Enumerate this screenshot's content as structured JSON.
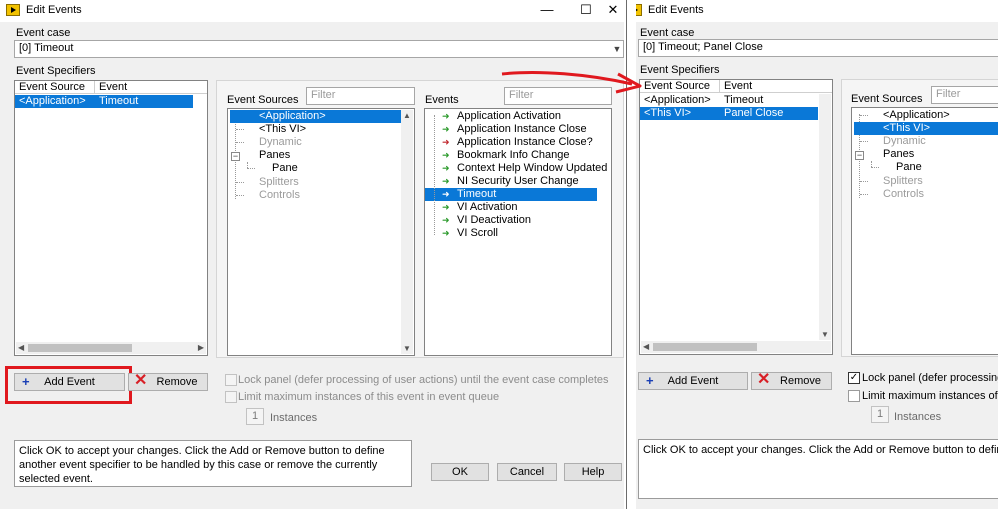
{
  "window": {
    "title": "Edit Events",
    "controls": {
      "minimize": "—",
      "maximize": "☐",
      "close": "✕"
    }
  },
  "left": {
    "event_case_label": "Event case",
    "event_case_value": "[0] Timeout",
    "event_specifiers_label": "Event Specifiers",
    "spec_columns": [
      "Event Source",
      "Event"
    ],
    "spec_rows": [
      {
        "source": "<Application>",
        "event": "Timeout",
        "selected": true
      }
    ],
    "event_sources_label": "Event Sources",
    "filter_placeholder": "Filter",
    "sources_tree": [
      {
        "label": "<Application>",
        "selected": true,
        "disabled": false
      },
      {
        "label": "<This VI>",
        "selected": false,
        "disabled": false
      },
      {
        "label": "Dynamic",
        "selected": false,
        "disabled": true
      },
      {
        "label": "Panes",
        "selected": false,
        "disabled": false
      },
      {
        "label": "Pane",
        "selected": false,
        "disabled": false
      },
      {
        "label": "Splitters",
        "selected": false,
        "disabled": true
      },
      {
        "label": "Controls",
        "selected": false,
        "disabled": true
      }
    ],
    "events_label": "Events",
    "events": [
      {
        "label": "Application Activation",
        "icon": "green-arrow",
        "selected": false
      },
      {
        "label": "Application Instance Close",
        "icon": "green-arrow",
        "selected": false
      },
      {
        "label": "Application Instance Close?",
        "icon": "red-arrow",
        "selected": false
      },
      {
        "label": "Bookmark Info Change",
        "icon": "green-arrow",
        "selected": false
      },
      {
        "label": "Context Help Window Updated",
        "icon": "green-arrow",
        "selected": false
      },
      {
        "label": "NI Security User Change",
        "icon": "green-arrow",
        "selected": false
      },
      {
        "label": "Timeout",
        "icon": "green-arrow",
        "selected": true
      },
      {
        "label": "VI Activation",
        "icon": "green-arrow",
        "selected": false
      },
      {
        "label": "VI Deactivation",
        "icon": "green-arrow",
        "selected": false
      },
      {
        "label": "VI Scroll",
        "icon": "green-arrow",
        "selected": false
      }
    ],
    "add_event": "Add Event",
    "remove": "Remove",
    "lock_panel": "Lock panel (defer processing of user actions) until the event case completes",
    "limit_instances": "Limit maximum instances of this event in event queue",
    "instances_value": "1",
    "instances_label": "Instances",
    "help_text": "Click OK to accept your changes.  Click the Add or Remove button to define another event specifier to be handled by this case or remove the currently selected event.",
    "ok": "OK",
    "cancel": "Cancel",
    "help": "Help"
  },
  "right": {
    "event_case_label": "Event case",
    "event_case_value": "[0] Timeout;  Panel Close",
    "event_specifiers_label": "Event Specifiers",
    "spec_columns": [
      "Event Source",
      "Event"
    ],
    "spec_rows": [
      {
        "source": "<Application>",
        "event": "Timeout",
        "selected": false
      },
      {
        "source": "<This VI>",
        "event": "Panel Close",
        "selected": true
      }
    ],
    "event_sources_label": "Event Sources",
    "filter_placeholder": "Filter",
    "sources_tree": [
      {
        "label": "<Application>",
        "selected": false,
        "disabled": false
      },
      {
        "label": "<This VI>",
        "selected": true,
        "disabled": false
      },
      {
        "label": "Dynamic",
        "selected": false,
        "disabled": true
      },
      {
        "label": "Panes",
        "selected": false,
        "disabled": false
      },
      {
        "label": "Pane",
        "selected": false,
        "disabled": false
      },
      {
        "label": "Splitters",
        "selected": false,
        "disabled": true
      },
      {
        "label": "Controls",
        "selected": false,
        "disabled": true
      }
    ],
    "add_event": "Add Event",
    "remove": "Remove",
    "lock_panel": "Lock panel (defer processing of",
    "lock_checked": true,
    "limit_instances": "Limit maximum instances of th",
    "instances_value": "1",
    "instances_label": "Instances",
    "help_text": "Click OK to accept your changes.  Click the Add or Remove button to define anothe"
  },
  "colors": {
    "selection": "#0a78d7",
    "annotation_red": "#e0181e",
    "event_icon_green": "#2b9a2b",
    "event_icon_red": "#c0272d"
  }
}
